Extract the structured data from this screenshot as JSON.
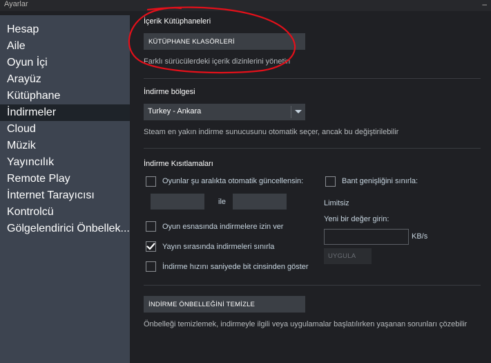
{
  "window": {
    "title": "Ayarlar",
    "minimize_symbol": "–"
  },
  "sidebar": {
    "items": [
      {
        "label": "Hesap",
        "active": false
      },
      {
        "label": "Aile",
        "active": false
      },
      {
        "label": "Oyun İçi",
        "active": false
      },
      {
        "label": "Arayüz",
        "active": false
      },
      {
        "label": "Kütüphane",
        "active": false
      },
      {
        "label": "İndirmeler",
        "active": true
      },
      {
        "label": "Cloud",
        "active": false
      },
      {
        "label": "Müzik",
        "active": false
      },
      {
        "label": "Yayıncılık",
        "active": false
      },
      {
        "label": "Remote Play",
        "active": false
      },
      {
        "label": "İnternet Tarayıcısı",
        "active": false
      },
      {
        "label": "Kontrolcü",
        "active": false
      },
      {
        "label": "Gölgelendirici Önbellek...",
        "active": false
      }
    ]
  },
  "content_libraries": {
    "heading": "İçerik Kütüphaneleri",
    "button_label": "KÜTÜPHANE KLASÖRLERİ",
    "description": "Farklı sürücülerdeki içerik dizinlerini yönetin"
  },
  "download_region": {
    "heading": "İndirme bölgesi",
    "selected": "Turkey - Ankara",
    "description": "Steam en yakın indirme sunucusunu otomatik seçer, ancak bu değiştirilebilir"
  },
  "download_restrictions": {
    "heading": "İndirme Kısıtlamaları",
    "auto_update_label": "Oyunlar şu aralıkta otomatik güncellensin:",
    "between_label": "ile",
    "start_value": "",
    "end_value": "",
    "allow_during_game_label": "Oyun esnasında indirmelere izin ver",
    "throttle_streaming_label": "Yayın sırasında indirmeleri sınırla",
    "bits_label": "İndirme hızını saniyede bit cinsinden göster",
    "limit_bandwidth_label": "Bant genişliğini sınırla:",
    "limit_status": "Limitsiz",
    "new_value_label": "Yeni bir değer girin:",
    "new_value": "",
    "unit": "KB/s",
    "apply_label": "UYGULA",
    "checked": {
      "auto_update": false,
      "allow_during_game": false,
      "throttle_streaming": true,
      "bits": false,
      "limit_bandwidth": false
    }
  },
  "cache": {
    "button_label": "İNDİRME ÖNBELLEĞİNİ TEMİZLE",
    "description": "Önbelleği temizlemek, indirmeyle ilgili veya uygulamalar başlatılırken yaşanan sorunları çözebilir"
  },
  "colors": {
    "annotation": "#e4101a",
    "sidebar_bg": "#3d4450",
    "sidebar_active": "#1e2329",
    "content_bg": "#1f2024",
    "button_bg": "#3b3f45"
  }
}
